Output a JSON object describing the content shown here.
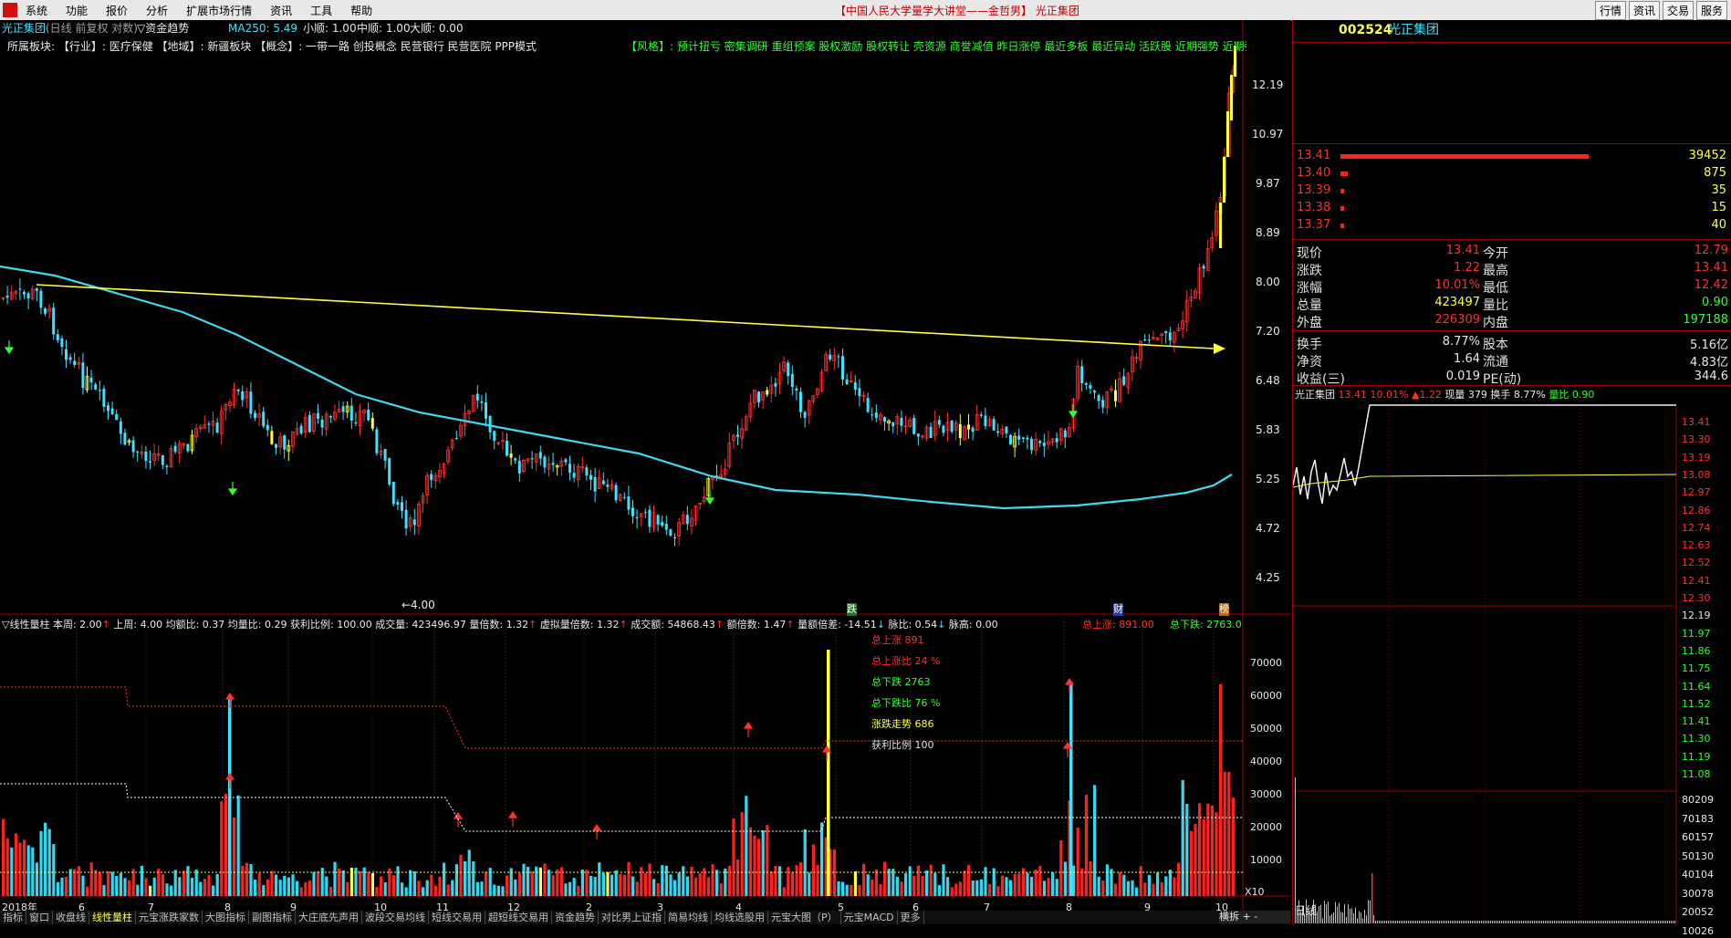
{
  "menu": [
    "系统",
    "功能",
    "报价",
    "分析",
    "扩展市场行情",
    "资讯",
    "工具",
    "帮助"
  ],
  "window_title": "【中国人民大学量学大讲堂——金哲男】 光正集团",
  "top_buttons": [
    "行情",
    "资讯",
    "交易",
    "服务"
  ],
  "chart_header": {
    "name": "光正集团",
    "mode": "(日线 前复权 对数)",
    "indicator": "▽资金趋势",
    "ma": "MA250: 5.49",
    "small": "小顺: 1.00",
    "mid": "中顺: 1.00",
    "big": "大顺: 0.00"
  },
  "sector_line": "所属板块: 【行业】: 医疗保健 【地域】: 新疆板块 【概念】: 一带一路 创投概念 民营银行 民营医院 PPP模式",
  "style_line": "【风格】: 预计扭亏 密集调研 重组预案 股权激励 股权转让 壳资源 商誉减值 昨日涨停 最近多板 最近异动 活跃股 近期强势 近期强",
  "price_axis": [
    "12.19",
    "10.97",
    "9.87",
    "8.89",
    "8.00",
    "7.20",
    "6.48",
    "5.83",
    "5.25",
    "4.72",
    "4.25"
  ],
  "low_label": "←4.00",
  "markers": {
    "die": "跌",
    "cai": "财",
    "bang": "榜"
  },
  "vol_header": {
    "name": "▽线性量柱",
    "items": [
      "本周: 2.00",
      "上周: 4.00",
      "均额比: 0.37",
      "均量比: 0.29",
      "获利比例: 100.00",
      "成交量: 423496.97",
      "量倍数: 1.32",
      "虚拟量倍数: 1.32",
      "成交额: 54868.43",
      "额倍数: 1.47",
      "量额倍差: -14.51",
      "脉比: 0.54",
      "脉高: 0.00"
    ],
    "up_total": "总上涨: 891.00",
    "down_total": "总下跌: 2763.0"
  },
  "vol_legend": [
    {
      "text": "总上涨 891",
      "color": "#ff3030"
    },
    {
      "text": "总上涨比 24 %",
      "color": "#ff3030"
    },
    {
      "text": "总下跌 2763",
      "color": "#30ff30"
    },
    {
      "text": "总下跌比 76 %",
      "color": "#30ff30"
    },
    {
      "text": "涨跌走势 686",
      "color": "#ffff40"
    },
    {
      "text": "获利比例 100",
      "color": "#e0e0e0"
    }
  ],
  "vol_axis": [
    "70000",
    "60000",
    "50000",
    "40000",
    "30000",
    "20000",
    "10000"
  ],
  "vol_scale": "X10",
  "months": [
    "2018年",
    "6",
    "7",
    "8",
    "9",
    "10",
    "11",
    "12",
    "2",
    "3",
    "4",
    "5",
    "6",
    "7",
    "8",
    "9",
    "10"
  ],
  "tabs": [
    "指标",
    "窗口",
    "收盘线",
    "线性量柱",
    "元宝涨跌家数",
    "大图指标",
    "副图指标",
    "大庄底先声用",
    "波段交易均线",
    "短线交易用",
    "超短线交易用",
    "资金趋势",
    "对比男上证指",
    "简易均线",
    "均线选股用",
    "元宝大图（P）",
    "元宝MACD",
    "更多"
  ],
  "active_tab": "线性量柱",
  "bottom_right": {
    "tab1": "横拆",
    "tab2": "+ -",
    "period": "日线"
  },
  "quote": {
    "code": "002524",
    "name": "光正集团",
    "book": [
      {
        "price": "13.41",
        "vol": "39452",
        "ratio": 1.0
      },
      {
        "price": "13.40",
        "vol": "875",
        "ratio": 0.03
      },
      {
        "price": "13.39",
        "vol": "35",
        "ratio": 0.008
      },
      {
        "price": "13.38",
        "vol": "15",
        "ratio": 0.008
      },
      {
        "price": "13.37",
        "vol": "40",
        "ratio": 0.008
      }
    ],
    "stats": [
      {
        "l1": "现价",
        "v1": "13.41",
        "c1": "#ff3030",
        "l2": "今开",
        "v2": "12.79",
        "c2": "#ff3030"
      },
      {
        "l1": "涨跌",
        "v1": "1.22",
        "c1": "#ff3030",
        "l2": "最高",
        "v2": "13.41",
        "c2": "#ff3030"
      },
      {
        "l1": "涨幅",
        "v1": "10.01%",
        "c1": "#ff3030",
        "l2": "最低",
        "v2": "12.42",
        "c2": "#ff3030"
      },
      {
        "l1": "总量",
        "v1": "423497",
        "c1": "#ffff40",
        "l2": "量比",
        "v2": "0.90",
        "c2": "#30ff30"
      },
      {
        "l1": "外盘",
        "v1": "226309",
        "c1": "#ff3030",
        "l2": "内盘",
        "v2": "197188",
        "c2": "#30ff30"
      }
    ],
    "stats2": [
      {
        "l1": "换手",
        "v1": "8.77%",
        "l2": "股本",
        "v2": "5.16亿"
      },
      {
        "l1": "净资",
        "v1": "1.64",
        "l2": "流通",
        "v2": "4.83亿"
      },
      {
        "l1": "收益(三)",
        "v1": "0.019",
        "l2": "PE(动)",
        "v2": "344.6"
      }
    ]
  },
  "intraday": {
    "header_name": "光正集团",
    "header_price": "13.41",
    "header_pct": "10.01%",
    "header_chg": "▲1.22",
    "header_cur": "现量 379",
    "header_turn": "换手 8.77%",
    "header_vr": "量比 0.90",
    "axis_up": [
      "13.41",
      "13.30",
      "13.19",
      "13.08",
      "12.97"
    ],
    "axis_mid": [
      "12.86",
      "12.74",
      "12.63",
      "12.52",
      "12.41",
      "12.30",
      "12.19"
    ],
    "axis_low": [
      "11.97",
      "11.86",
      "11.75",
      "11.64",
      "11.52",
      "11.41",
      "11.30",
      "11.19",
      "11.08"
    ],
    "vol_axis": [
      "80209",
      "70183",
      "60157",
      "50130",
      "40104",
      "30078",
      "20052",
      "10026"
    ]
  },
  "chart_data": {
    "type": "candlestick",
    "title": "光正集团 日线 前复权 对数",
    "ma250_last": 5.49,
    "price_low": 4.0,
    "price_high": 13.41,
    "trendline": {
      "from": 7.95,
      "to": 6.95
    },
    "volume_max": 70000
  }
}
